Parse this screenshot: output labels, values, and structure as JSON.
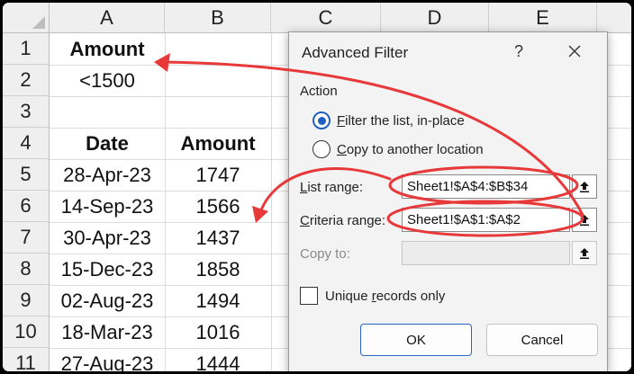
{
  "sheet": {
    "columns": [
      "A",
      "B",
      "C",
      "D",
      "E"
    ],
    "rows": [
      "1",
      "2",
      "3",
      "4",
      "5",
      "6",
      "7",
      "8",
      "9",
      "10",
      "11"
    ],
    "criteria": {
      "header": "Amount",
      "value": "<1500"
    },
    "table": {
      "headers": [
        "Date",
        "Amount"
      ],
      "records": [
        [
          "28-Apr-23",
          "1747"
        ],
        [
          "14-Sep-23",
          "1566"
        ],
        [
          "30-Apr-23",
          "1437"
        ],
        [
          "15-Dec-23",
          "1858"
        ],
        [
          "02-Aug-23",
          "1494"
        ],
        [
          "18-Mar-23",
          "1016"
        ],
        [
          "27-Aug-23",
          "1444"
        ]
      ]
    }
  },
  "dialog": {
    "title": "Advanced Filter",
    "help_label": "?",
    "action_label": "Action",
    "options": [
      {
        "label": "Filter the list, in-place",
        "selected": true
      },
      {
        "label": "Copy to another location",
        "selected": false
      }
    ],
    "list_range": {
      "label": "List range:",
      "value": "Sheet1!$A$4:$B$34"
    },
    "criteria_range": {
      "label": "Criteria range:",
      "value": "Sheet1!$A$1:$A$2"
    },
    "copy_to": {
      "label": "Copy to:",
      "value": ""
    },
    "unique_label": "Unique records only",
    "unique_checked": false,
    "ok_label": "OK",
    "cancel_label": "Cancel"
  },
  "icons": [
    "close-icon",
    "collapse-dialog-icon",
    "curved-arrow-annotation"
  ],
  "colors": {
    "annotation": "#e8393a",
    "radio_accent": "#1f5fbf",
    "ok_border": "#2a67c4"
  }
}
